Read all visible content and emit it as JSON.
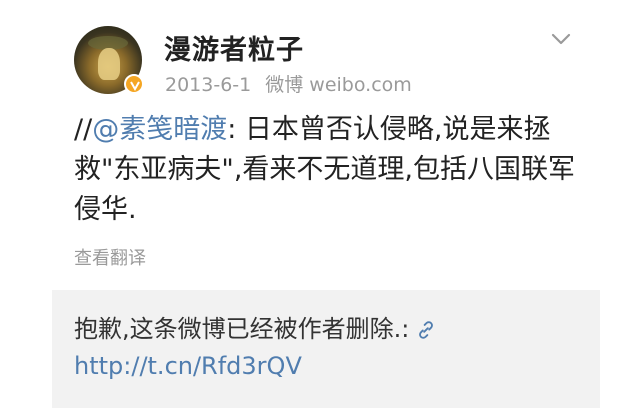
{
  "header": {
    "username": "漫游者粒子",
    "date": "2013-6-1",
    "source": "微博 weibo.com"
  },
  "post": {
    "prefix": "//",
    "mention": "@素笺暗渡",
    "text": ": 日本曾否认侵略,说是来拯救\"东亚病夫\",看来不无道理,包括八国联军侵华.",
    "translate_label": "查看翻译"
  },
  "retweet": {
    "text": "抱歉,这条微博已经被作者删除.:",
    "url": "http://t.cn/Rfd3rQV"
  },
  "icons": {
    "verified": "verified-badge-icon",
    "menu": "chevron-down-icon",
    "link": "link-icon"
  },
  "colors": {
    "link": "#507daf",
    "badge": "#f5a623",
    "muted": "#9a9a9a",
    "retweet_bg": "#f2f2f2"
  }
}
